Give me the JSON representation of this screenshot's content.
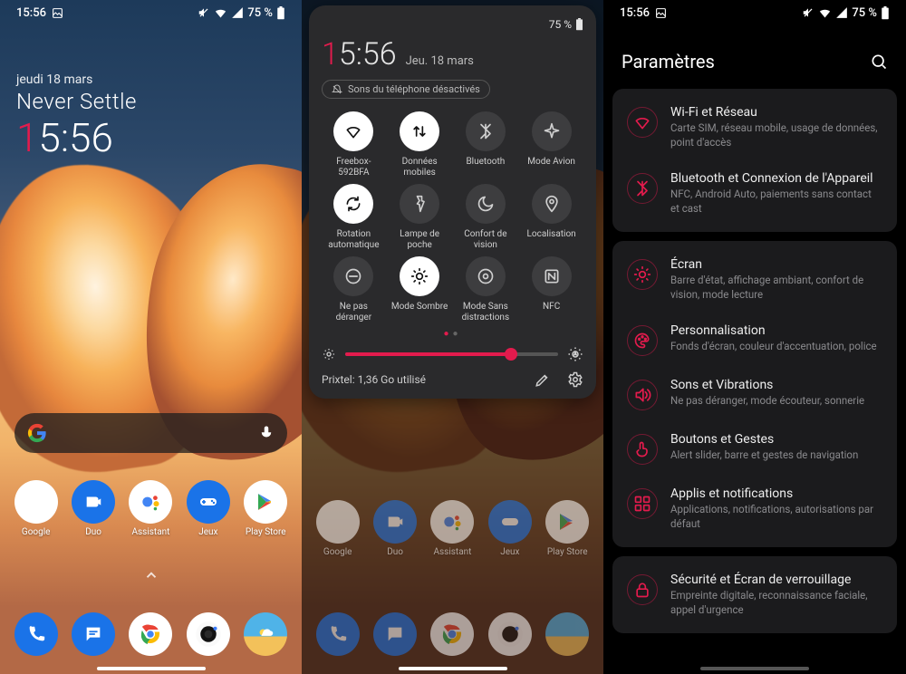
{
  "status": {
    "time": "15:56",
    "battery": "75 %"
  },
  "home": {
    "date": "jeudi 18 mars",
    "slogan": "Never Settle",
    "time_h1": "1",
    "time_rest": "5:56",
    "apps": [
      {
        "label": "Google",
        "bg": "#ffffff"
      },
      {
        "label": "Duo",
        "bg": "#1a73e8"
      },
      {
        "label": "Assistant",
        "bg": "#ffffff"
      },
      {
        "label": "Jeux",
        "bg": "#1a73e8"
      },
      {
        "label": "Play Store",
        "bg": "#ffffff"
      }
    ],
    "dock": [
      {
        "label": "Phone",
        "bg": "#1a73e8"
      },
      {
        "label": "Messages",
        "bg": "#1a73e8"
      },
      {
        "label": "Chrome",
        "bg": "#ffffff"
      },
      {
        "label": "Camera",
        "bg": "#ffffff"
      },
      {
        "label": "Weather",
        "bg": "#3ea6e0"
      }
    ]
  },
  "qs": {
    "time_h1": "1",
    "time_rest": "5:56",
    "date": "Jeu. 18 mars",
    "pill": "Sons du téléphone désactivés",
    "tiles": [
      {
        "label": "Freebox-592BFA",
        "on": true,
        "icon": "wifi"
      },
      {
        "label": "Données mobiles",
        "on": true,
        "icon": "data"
      },
      {
        "label": "Bluetooth",
        "on": false,
        "icon": "bluetooth"
      },
      {
        "label": "Mode Avion",
        "on": false,
        "icon": "airplane"
      },
      {
        "label": "Rotation automatique",
        "on": true,
        "icon": "rotate"
      },
      {
        "label": "Lampe de poche",
        "on": false,
        "icon": "flash"
      },
      {
        "label": "Confort de vision",
        "on": false,
        "icon": "moon"
      },
      {
        "label": "Localisation",
        "on": false,
        "icon": "location"
      },
      {
        "label": "Ne pas déranger",
        "on": false,
        "icon": "dnd"
      },
      {
        "label": "Mode Sombre",
        "on": true,
        "icon": "dark"
      },
      {
        "label": "Mode Sans distractions",
        "on": false,
        "icon": "zen"
      },
      {
        "label": "NFC",
        "on": false,
        "icon": "nfc"
      }
    ],
    "brightness_pct": 78,
    "data_usage": "Prixtel: 1,36 Go utilisé"
  },
  "settings": {
    "title": "Paramètres",
    "groups": [
      [
        {
          "t": "Wi-Fi et Réseau",
          "s": "Carte SIM, réseau mobile, usage de données, point d'accès",
          "ic": "wifi"
        },
        {
          "t": "Bluetooth et Connexion de l'Appareil",
          "s": "NFC, Android Auto, paiements sans contact et cast",
          "ic": "bluetooth"
        }
      ],
      [
        {
          "t": "Écran",
          "s": "Barre d'état, affichage ambiant, confort de vision, mode lecture",
          "ic": "sun"
        },
        {
          "t": "Personnalisation",
          "s": "Fonds d'écran, couleur d'accentuation, police",
          "ic": "palette"
        },
        {
          "t": "Sons et Vibrations",
          "s": "Ne pas déranger, mode écouteur, sonnerie",
          "ic": "sound"
        },
        {
          "t": "Boutons et Gestes",
          "s": "Alert slider, barre et gestes de navigation",
          "ic": "gesture"
        },
        {
          "t": "Applis et notifications",
          "s": "Applications, notifications, autorisations par défaut",
          "ic": "apps"
        }
      ],
      [
        {
          "t": "Sécurité et Écran de verrouillage",
          "s": "Empreinte digitale, reconnaissance faciale, appel d'urgence",
          "ic": "lock"
        }
      ]
    ]
  }
}
